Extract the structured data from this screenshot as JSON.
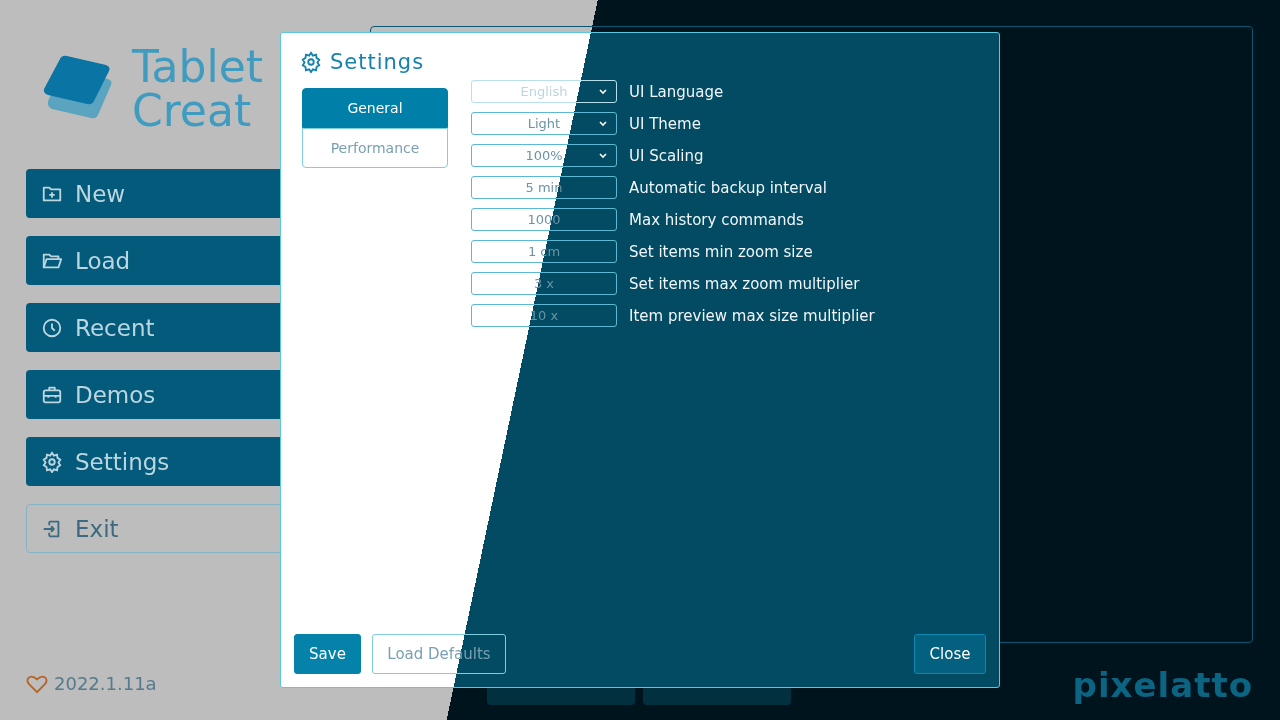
{
  "launcher": {
    "logo_lines": [
      "Tablet",
      "Creat"
    ],
    "menu": [
      {
        "label": "New",
        "kind": "filled"
      },
      {
        "label": "Load",
        "kind": "filled"
      },
      {
        "label": "Recent",
        "kind": "filled"
      },
      {
        "label": "Demos",
        "kind": "filled"
      },
      {
        "label": "Settings",
        "kind": "filled"
      },
      {
        "label": "Exit",
        "kind": "outline"
      }
    ],
    "version": "2022.1.11a",
    "brand": "pixelatto"
  },
  "settings_dialog": {
    "title": "Settings",
    "tabs": [
      {
        "label": "General",
        "selected": true
      },
      {
        "label": "Performance",
        "selected": false
      }
    ],
    "fields": [
      {
        "kind": "select",
        "value": "English",
        "label": "UI Language",
        "disabled": true
      },
      {
        "kind": "select",
        "value": "Light",
        "label": "UI Theme",
        "disabled": false
      },
      {
        "kind": "select",
        "value": "100%",
        "label": "UI Scaling",
        "disabled": false
      },
      {
        "kind": "input",
        "value": "5 min",
        "label": "Automatic backup interval",
        "disabled": false
      },
      {
        "kind": "input",
        "value": "1000",
        "label": "Max history commands",
        "disabled": false
      },
      {
        "kind": "input",
        "value": "1 cm",
        "label": "Set items min zoom size",
        "disabled": false
      },
      {
        "kind": "input",
        "value": "3 x",
        "label": "Set items max zoom multiplier",
        "disabled": false
      },
      {
        "kind": "input",
        "value": "10 x",
        "label": "Item preview max size multiplier",
        "disabled": false
      }
    ],
    "buttons": [
      {
        "label": "Save",
        "kind": "primary"
      },
      {
        "label": "Load Defaults",
        "kind": "secondary"
      },
      {
        "label": "Close",
        "kind": "close"
      }
    ]
  }
}
